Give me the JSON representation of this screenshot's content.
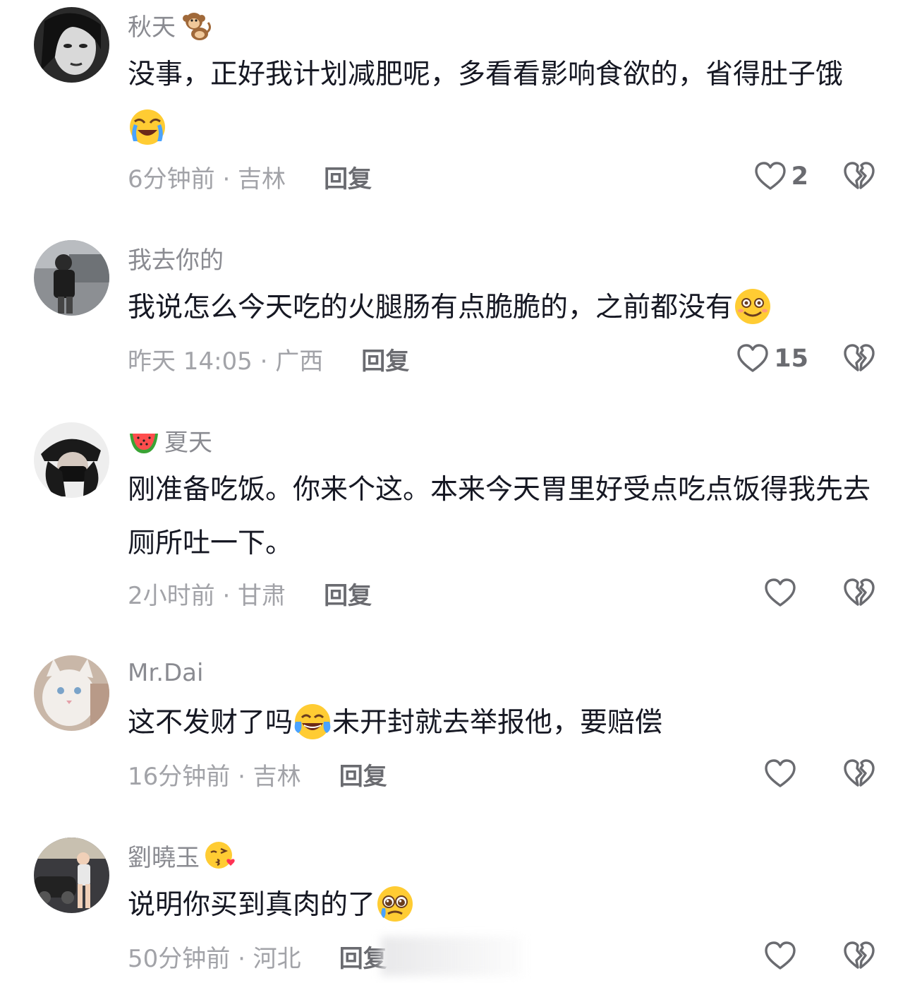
{
  "comments": [
    {
      "username": "秋天",
      "username_emoji": "monkey-emoji",
      "text_before_emoji": "没事，正好我计划减肥呢，多看看影响食欲的，省得肚子饿",
      "text_emoji": "loudly-crying-face-emoji",
      "text_after_emoji": "",
      "time_location": "6分钟前 · 吉林",
      "reply_label": "回复",
      "like_count": "2"
    },
    {
      "username": "我去你的",
      "username_emoji": "",
      "text_before_emoji": "我说怎么今天吃的火腿肠有点脆脆的，之前都没有",
      "text_emoji": "flushed-smile-emoji",
      "text_after_emoji": "",
      "time_location": "昨天 14:05 · 广西",
      "reply_label": "回复",
      "like_count": "15"
    },
    {
      "username": "夏天",
      "username_emoji_prefix": "watermelon-emoji",
      "text_before_emoji": "刚准备吃饭。你来个这。本来今天胃里好受点吃点饭得我先去厕所吐一下。",
      "text_emoji": "",
      "text_after_emoji": "",
      "time_location": "2小时前 · 甘肃",
      "reply_label": "回复",
      "like_count": ""
    },
    {
      "username": "Mr.Dai",
      "username_emoji": "",
      "text_before_emoji": "这不发财了吗",
      "text_emoji": "tears-of-joy-emoji",
      "text_after_emoji": "未开封就去举报他，要赔偿",
      "time_location": "16分钟前 · 吉林",
      "reply_label": "回复",
      "like_count": ""
    },
    {
      "username": "劉曉玉",
      "username_emoji": "kissing-heart-emoji",
      "text_before_emoji": "说明你买到真肉的了",
      "text_emoji": "pleading-face-emoji",
      "text_after_emoji": "",
      "time_location": "50分钟前 · 河北",
      "reply_label": "回复",
      "like_count": ""
    }
  ],
  "colors": {
    "text": "#161823",
    "username": "#8a8b91",
    "meta": "#a2a3a8",
    "reply": "#6a6b70",
    "icon_stroke": "#6a6b70"
  },
  "icons": {
    "like": "heart-outline-icon",
    "dislike": "broken-heart-icon"
  }
}
